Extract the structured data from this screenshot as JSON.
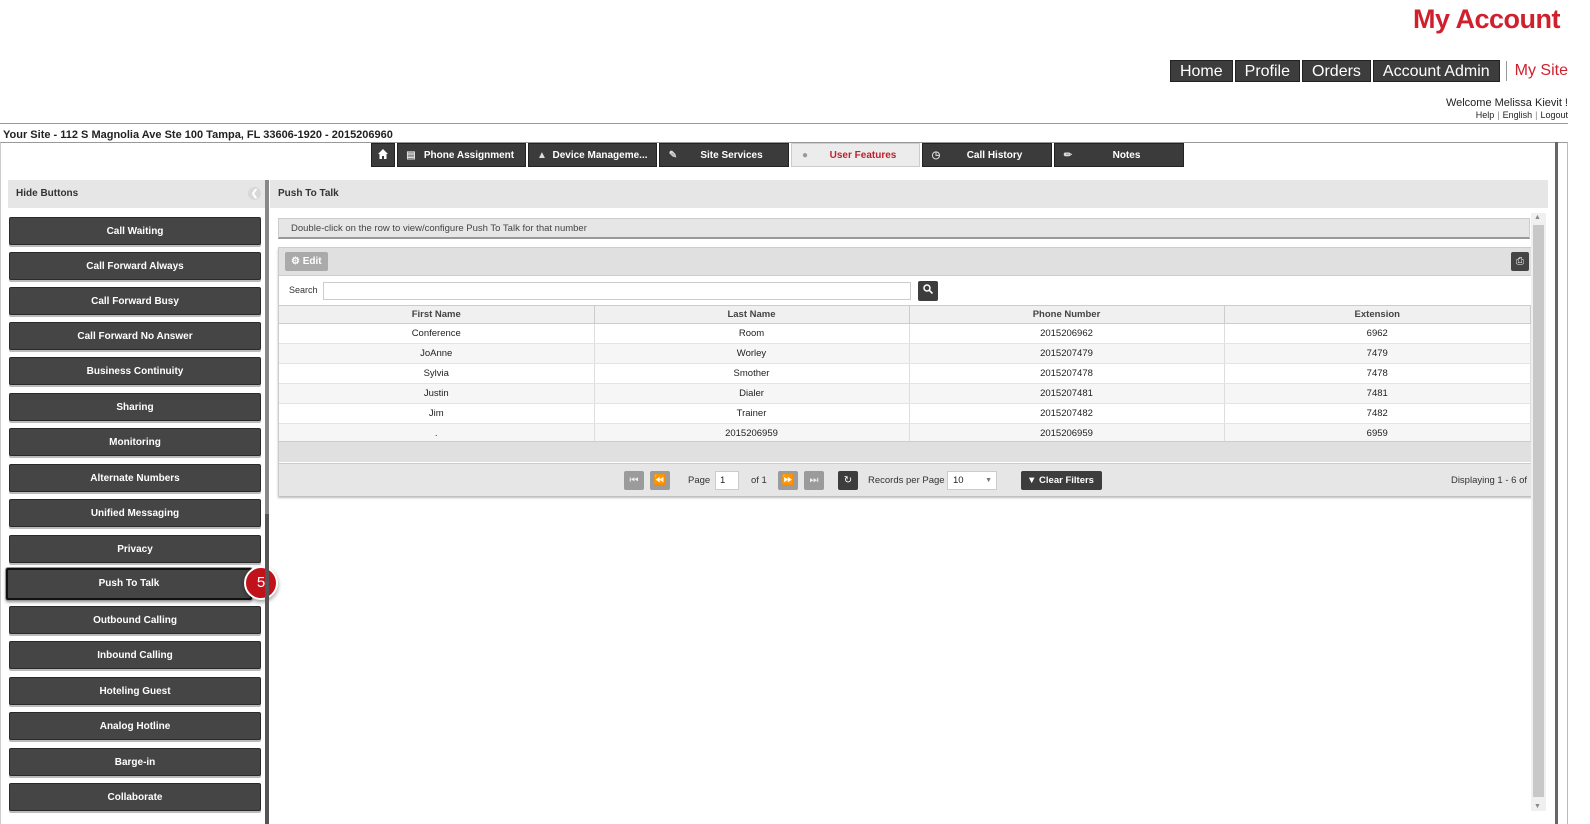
{
  "brand": "My Account",
  "topnav": {
    "items": [
      "Home",
      "Profile",
      "Orders",
      "Account Admin"
    ],
    "active": "My Site"
  },
  "user": {
    "welcome": "Welcome Melissa Kievit !",
    "links": [
      "Help",
      "English",
      "Logout"
    ]
  },
  "site_info": "Your Site - 112 S Magnolia Ave Ste 100 Tampa, FL 33606-1920 - 2015206960",
  "tabs": [
    {
      "label": "Phone Assignment",
      "icon": "list-icon"
    },
    {
      "label": "Device Manageme...",
      "icon": "bell-icon"
    },
    {
      "label": "Site Services",
      "icon": "edit-icon"
    },
    {
      "label": "User Features",
      "icon": "user-icon",
      "active": true
    },
    {
      "label": "Call History",
      "icon": "clock-icon"
    },
    {
      "label": "Notes",
      "icon": "pencil-icon"
    }
  ],
  "sidebar": {
    "header": "Hide Buttons",
    "buttons": [
      "Call Waiting",
      "Call Forward Always",
      "Call Forward Busy",
      "Call Forward No Answer",
      "Business Continuity",
      "Sharing",
      "Monitoring",
      "Alternate Numbers",
      "Unified Messaging",
      "Privacy",
      "Push To Talk",
      "Outbound Calling",
      "Inbound Calling",
      "Hoteling Guest",
      "Analog Hotline",
      "Barge-in",
      "Collaborate"
    ],
    "selected": "Push To Talk",
    "step_badge": "5"
  },
  "main": {
    "title": "Push To Talk",
    "hint": "Double-click on the row to view/configure Push To Talk for that number",
    "edit_label": "Edit",
    "search_label": "Search",
    "search_value": "",
    "columns": [
      "First Name",
      "Last Name",
      "Phone Number",
      "Extension"
    ],
    "rows": [
      [
        "Conference",
        "Room",
        "2015206962",
        "6962"
      ],
      [
        "JoAnne",
        "Worley",
        "2015207479",
        "7479"
      ],
      [
        "Sylvia",
        "Smother",
        "2015207478",
        "7478"
      ],
      [
        "Justin",
        "Dialer",
        "2015207481",
        "7481"
      ],
      [
        "Jim",
        "Trainer",
        "2015207482",
        "7482"
      ],
      [
        ".",
        "2015206959",
        "2015206959",
        "6959"
      ]
    ],
    "pager": {
      "page_label": "Page",
      "page_value": "1",
      "of_label": "of 1",
      "records_label": "Records per Page",
      "records_value": "10",
      "clear_filters": "Clear Filters",
      "displaying": "Displaying 1 - 6 of"
    }
  },
  "colors": {
    "brand_red": "#d0202e",
    "dark_button": "#454545",
    "panel_gray": "#e6e6e6"
  }
}
